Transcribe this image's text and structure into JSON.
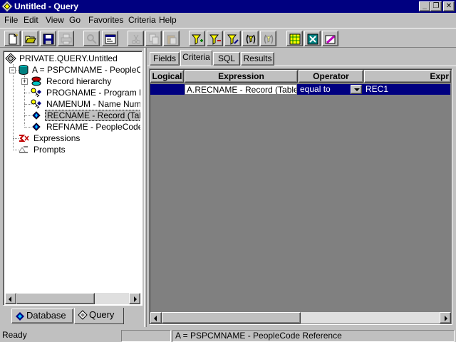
{
  "window": {
    "title": "Untitled - Query"
  },
  "menu": [
    {
      "label": "File"
    },
    {
      "label": "Edit"
    },
    {
      "label": "View"
    },
    {
      "label": "Go"
    },
    {
      "label": "Favorites"
    },
    {
      "label": "Criteria"
    },
    {
      "label": "Help"
    }
  ],
  "tree": {
    "root": "PRIVATE.QUERY.Untitled",
    "record": "A = PSPCMNAME - PeopleCode Reference",
    "hierarchy": "Record hierarchy",
    "fields": [
      {
        "label": "PROGNAME - Program Name",
        "icon": "key-icon"
      },
      {
        "label": "NAMENUM - Name Number",
        "icon": "key-icon"
      },
      {
        "label": "RECNAME - Record (Table) Name",
        "icon": "field-diamond-icon"
      },
      {
        "label": "REFNAME - PeopleCode Reference Name",
        "icon": "field-diamond-icon"
      }
    ],
    "expressions": "Expressions",
    "prompts": "Prompts"
  },
  "left_tabs": [
    {
      "label": "Database"
    },
    {
      "label": "Query"
    }
  ],
  "right_tabs": [
    {
      "label": "Fields"
    },
    {
      "label": "Criteria"
    },
    {
      "label": "SQL"
    },
    {
      "label": "Results"
    }
  ],
  "active_right_tab": "Criteria",
  "grid": {
    "headers": [
      "Logical",
      "Expression",
      "Operator",
      "Expr"
    ],
    "rows": [
      {
        "logical": "",
        "expression": "A.RECNAME - Record (Table) Name",
        "operator": "equal to",
        "expr2": "REC1"
      }
    ]
  },
  "status": {
    "left": "Ready",
    "middle": "",
    "right": "A = PSPCMNAME - PeopleCode Reference"
  },
  "colors": {
    "titlebar": "#000080",
    "selection": "#000080",
    "face": "#c0c0c0"
  }
}
